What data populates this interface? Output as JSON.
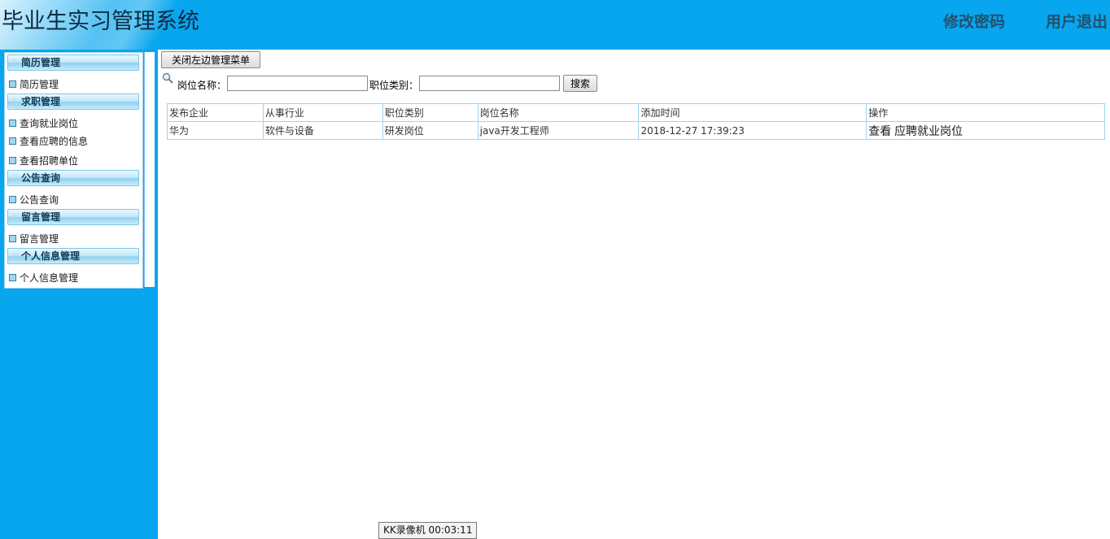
{
  "header": {
    "title": "毕业生实习管理系统",
    "change_password": "修改密码",
    "logout": "用户退出"
  },
  "sidebar": {
    "groups": [
      {
        "title": "简历管理",
        "items": [
          "简历管理"
        ]
      },
      {
        "title": "求职管理",
        "items": [
          "查询就业岗位",
          "查看应聘的信息",
          "查看招聘单位"
        ]
      },
      {
        "title": "公告查询",
        "items": [
          "公告查询"
        ]
      },
      {
        "title": "留言管理",
        "items": [
          "留言管理"
        ]
      },
      {
        "title": "个人信息管理",
        "items": [
          "个人信息管理"
        ]
      }
    ]
  },
  "toolbar": {
    "close_menu_button": "关闭左边管理菜单",
    "search_icon": "search-icon",
    "job_name_label": "岗位名称：",
    "job_name_value": "",
    "job_category_label": "职位类别：",
    "job_category_value": "",
    "search_button": "搜索"
  },
  "table": {
    "headers": [
      "发布企业",
      "从事行业",
      "职位类别",
      "岗位名称",
      "添加时间",
      "操作"
    ],
    "rows": [
      {
        "company": "华为",
        "industry": "软件与设备",
        "category": "研发岗位",
        "job_name": "java开发工程师",
        "added_time": "2018-12-27 17:39:23",
        "actions": [
          "查看",
          "应聘就业岗位"
        ]
      }
    ]
  },
  "overlay": {
    "recorder_label": "KK录像机 00:03:11"
  },
  "colors": {
    "header_bg": "#07a6ee",
    "sidebar_bg": "#07a6ee",
    "table_border": "#9fd3ee"
  }
}
